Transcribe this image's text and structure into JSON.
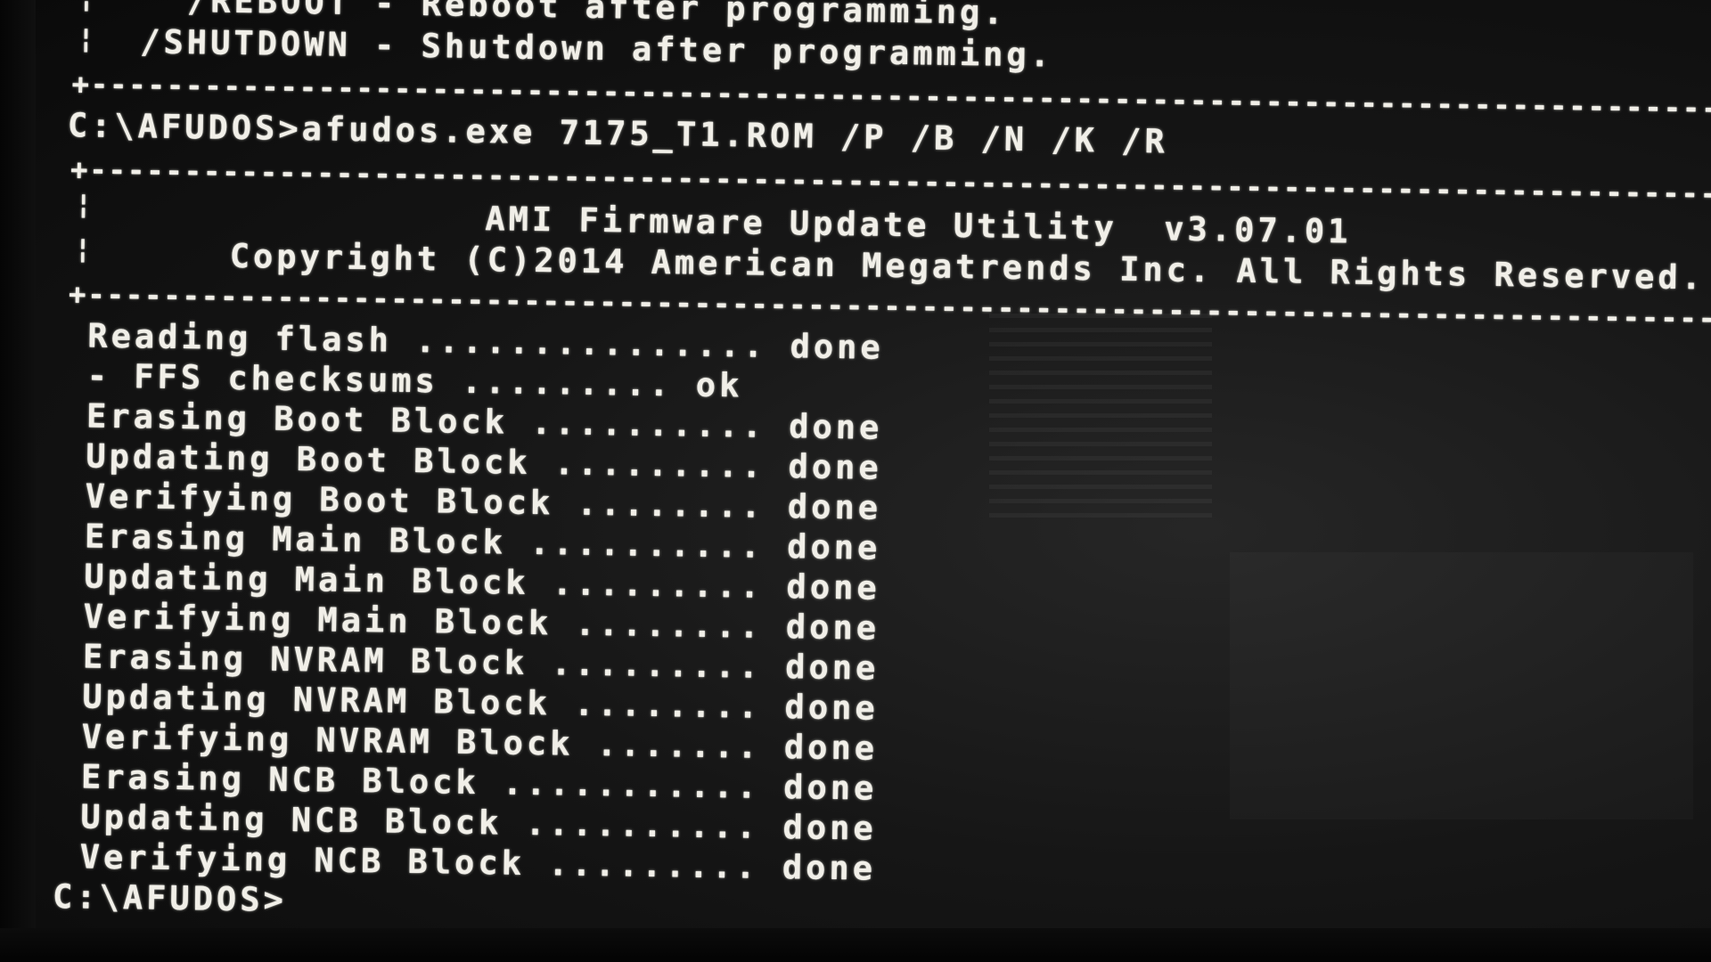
{
  "options_tail": [
    {
      "switch": "/REBOOT",
      "desc": "Reboot after programming."
    },
    {
      "switch": "/SHUTDOWN",
      "desc": "Shutdown after programming."
    }
  ],
  "command_line": "C:\\AFUDOS>afudos.exe 7175_T1.ROM /P /B /N /K /R",
  "header": {
    "title": "AMI Firmware Update Utility  v3.07.01",
    "copyright": "Copyright (C)2014 American Megatrends Inc. All Rights Reserved."
  },
  "progress_lines": [
    {
      "text": "Reading flash ...............",
      "status": "done"
    },
    {
      "text": "- FFS checksums .........",
      "status": "ok"
    },
    {
      "text": "Erasing Boot Block ..........",
      "status": "done"
    },
    {
      "text": "Updating Boot Block .........",
      "status": "done"
    },
    {
      "text": "Verifying Boot Block ........",
      "status": "done"
    },
    {
      "text": "Erasing Main Block ..........",
      "status": "done"
    },
    {
      "text": "Updating Main Block .........",
      "status": "done"
    },
    {
      "text": "Verifying Main Block ........",
      "status": "done"
    },
    {
      "text": "Erasing NVRAM Block .........",
      "status": "done"
    },
    {
      "text": "Updating NVRAM Block ........",
      "status": "done"
    },
    {
      "text": "Verifying NVRAM Block .......",
      "status": "done"
    },
    {
      "text": "Erasing NCB Block ...........",
      "status": "done"
    },
    {
      "text": "Updating NCB Block ..........",
      "status": "done"
    },
    {
      "text": "Verifying NCB Block .........",
      "status": "done"
    }
  ],
  "prompt": "C:\\AFUDOS>",
  "colors": {
    "text": "#f1efe8",
    "background": "#161616"
  }
}
